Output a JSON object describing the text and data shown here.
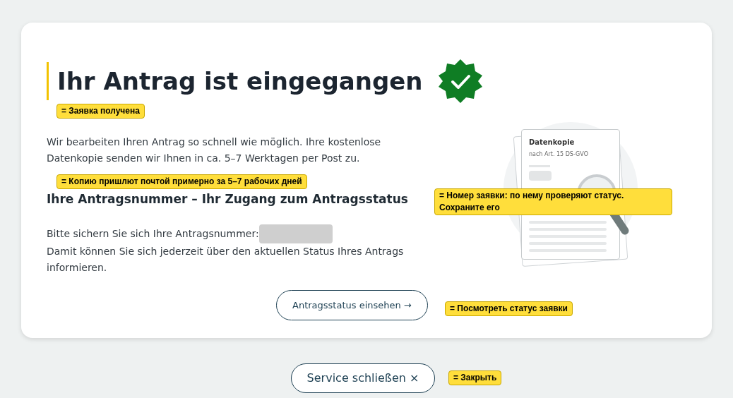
{
  "card": {
    "title": "Ihr Antrag ist eingegangen",
    "intro": "Wir bearbeiten Ihren Antrag so schnell wie möglich. Ihre kostenlose Datenkopie senden wir Ihnen in ca. 5–7 Werktagen per Post zu.",
    "subtitle": "Ihre Antragsnummer – Ihr Zugang zum Antragsstatus",
    "number_label": "Bitte sichern Sie sich Ihre Antragsnummer:",
    "number_redacted": true,
    "number_note": "Damit können Sie sich jederzeit über den aktuellen Status Ihres Antrags informieren.",
    "illustration": {
      "doc_title": "Datenkopie",
      "doc_subtitle": "nach Art. 15 DS-GVO"
    },
    "status_button": "Antragsstatus einsehen →"
  },
  "close_button": "Service schließen ×",
  "annotations": [
    {
      "text": "= Заявка получена"
    },
    {
      "text": "= Копию пришлют почтой примерно за 5–7 рабочих дней"
    },
    {
      "text": "= Номер заявки: по нему проверяют статус. Сохраните его"
    },
    {
      "text": "= Посмотреть статус заявки"
    },
    {
      "text": "= Закрыть"
    }
  ]
}
